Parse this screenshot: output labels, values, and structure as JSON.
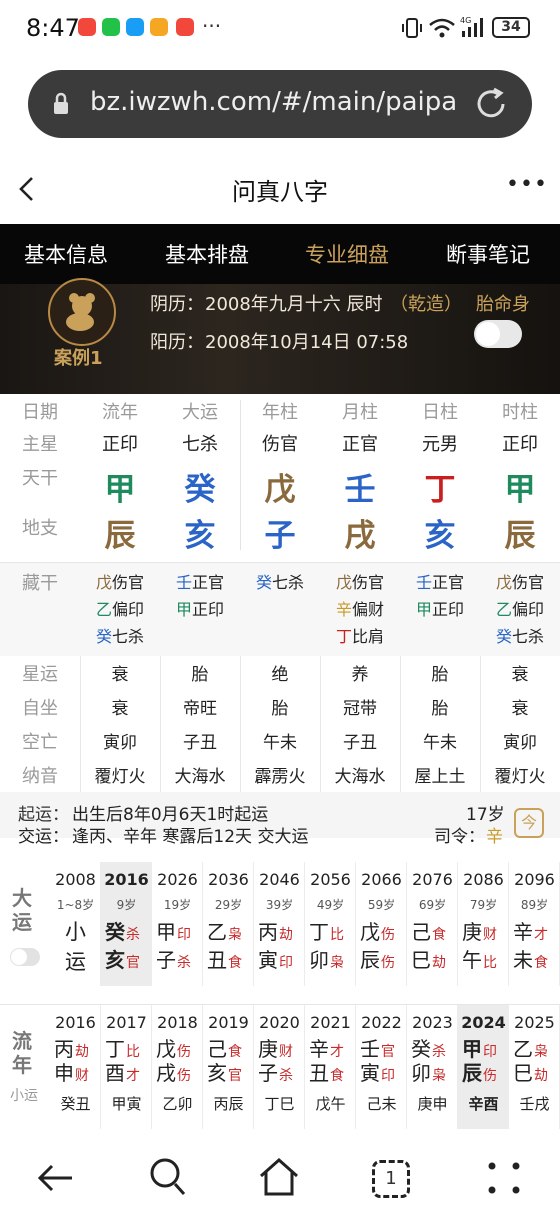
{
  "status": {
    "time": "8:47",
    "dots": "···",
    "battery": "34"
  },
  "browser": {
    "url": "bz.iwzwh.com/#/main/paipa"
  },
  "nav": {
    "title": "问真八字",
    "more": "•••"
  },
  "tabs": [
    "基本信息",
    "基本排盘",
    "专业细盘",
    "断事笔记"
  ],
  "info": {
    "case": "案例1",
    "lunar_label": "阴历：",
    "lunar": "2008年九月十六 辰时",
    "gender": "（乾造）",
    "solar_label": "阳历：",
    "solar": "2008年10月14日 07:58",
    "toggle_label": "胎命身"
  },
  "pillars": {
    "headers": [
      "日期",
      "流年",
      "大运",
      "年柱",
      "月柱",
      "日柱",
      "时柱"
    ],
    "zhuxing": {
      "label": "主星",
      "values": [
        "正印",
        "七杀",
        "伤官",
        "正官",
        "元男",
        "正印"
      ]
    },
    "tiangan": {
      "label": "天干",
      "values": [
        "甲",
        "癸",
        "戊",
        "壬",
        "丁",
        "甲"
      ],
      "colors": [
        "#1f8a5e",
        "#2a64c6",
        "#8a6a3c",
        "#2a64c6",
        "#c81f1f",
        "#1f8a5e"
      ]
    },
    "dizhi": {
      "label": "地支",
      "values": [
        "辰",
        "亥",
        "子",
        "戌",
        "亥",
        "辰"
      ],
      "colors": [
        "#8a6a3c",
        "#2a64c6",
        "#2a64c6",
        "#8a6a3c",
        "#2a64c6",
        "#8a6a3c"
      ]
    }
  },
  "canggan": {
    "label": "藏干",
    "cols": [
      [
        [
          "戊",
          "伤官",
          "#8a6a3c"
        ],
        [
          "乙",
          "偏印",
          "#1f8a5e"
        ],
        [
          "癸",
          "七杀",
          "#2a64c6"
        ]
      ],
      [
        [
          "壬",
          "正官",
          "#2a64c6"
        ],
        [
          "甲",
          "正印",
          "#1f8a5e"
        ]
      ],
      [
        [
          "癸",
          "七杀",
          "#2a64c6"
        ]
      ],
      [
        [
          "戊",
          "伤官",
          "#8a6a3c"
        ],
        [
          "辛",
          "偏财",
          "#c89a2a"
        ],
        [
          "丁",
          "比肩",
          "#c81f1f"
        ]
      ],
      [
        [
          "壬",
          "正官",
          "#2a64c6"
        ],
        [
          "甲",
          "正印",
          "#1f8a5e"
        ]
      ],
      [
        [
          "戊",
          "伤官",
          "#8a6a3c"
        ],
        [
          "乙",
          "偏印",
          "#1f8a5e"
        ],
        [
          "癸",
          "七杀",
          "#2a64c6"
        ]
      ]
    ]
  },
  "extra": [
    {
      "label": "星运",
      "values": [
        "衰",
        "胎",
        "绝",
        "养",
        "胎",
        "衰"
      ]
    },
    {
      "label": "自坐",
      "values": [
        "衰",
        "帝旺",
        "胎",
        "冠带",
        "胎",
        "衰"
      ]
    },
    {
      "label": "空亡",
      "values": [
        "寅卯",
        "子丑",
        "午未",
        "子丑",
        "午未",
        "寅卯"
      ]
    },
    {
      "label": "纳音",
      "values": [
        "覆灯火",
        "大海水",
        "霹雳火",
        "大海水",
        "屋上土",
        "覆灯火"
      ]
    }
  ],
  "qiyun": {
    "line1_label": "起运：",
    "line1": "出生后8年0月6天1时起运",
    "line2_label": "交运：",
    "line2": "逢丙、辛年 寒露后12天 交大运",
    "age": "17岁",
    "siling_label": "司令：",
    "siling": "辛",
    "calendar_icon": "今"
  },
  "dayun": {
    "label": "大运",
    "items": [
      {
        "year": "2008",
        "age": "1~8岁",
        "top": "小",
        "bot": "运"
      },
      {
        "year": "2016",
        "age": "9岁",
        "g": "癸",
        "gs": "杀",
        "z": "亥",
        "zs": "官",
        "sel": true
      },
      {
        "year": "2026",
        "age": "19岁",
        "g": "甲",
        "gs": "印",
        "z": "子",
        "zs": "杀"
      },
      {
        "year": "2036",
        "age": "29岁",
        "g": "乙",
        "gs": "枭",
        "z": "丑",
        "zs": "食"
      },
      {
        "year": "2046",
        "age": "39岁",
        "g": "丙",
        "gs": "劫",
        "z": "寅",
        "zs": "印"
      },
      {
        "year": "2056",
        "age": "49岁",
        "g": "丁",
        "gs": "比",
        "z": "卯",
        "zs": "枭"
      },
      {
        "year": "2066",
        "age": "59岁",
        "g": "戊",
        "gs": "伤",
        "z": "辰",
        "zs": "伤"
      },
      {
        "year": "2076",
        "age": "69岁",
        "g": "己",
        "gs": "食",
        "z": "巳",
        "zs": "劫"
      },
      {
        "year": "2086",
        "age": "79岁",
        "g": "庚",
        "gs": "财",
        "z": "午",
        "zs": "比"
      },
      {
        "year": "2096",
        "age": "89岁",
        "g": "辛",
        "gs": "才",
        "z": "未",
        "zs": "食"
      }
    ]
  },
  "liunian": {
    "label": "流年",
    "sub": "小运",
    "items": [
      {
        "year": "2016",
        "g": "丙",
        "gs": "劫",
        "z": "申",
        "zs": "财",
        "x": "癸丑"
      },
      {
        "year": "2017",
        "g": "丁",
        "gs": "比",
        "z": "酉",
        "zs": "才",
        "x": "甲寅"
      },
      {
        "year": "2018",
        "g": "戊",
        "gs": "伤",
        "z": "戌",
        "zs": "伤",
        "x": "乙卯"
      },
      {
        "year": "2019",
        "g": "己",
        "gs": "食",
        "z": "亥",
        "zs": "官",
        "x": "丙辰"
      },
      {
        "year": "2020",
        "g": "庚",
        "gs": "财",
        "z": "子",
        "zs": "杀",
        "x": "丁巳"
      },
      {
        "year": "2021",
        "g": "辛",
        "gs": "才",
        "z": "丑",
        "zs": "食",
        "x": "戊午"
      },
      {
        "year": "2022",
        "g": "壬",
        "gs": "官",
        "z": "寅",
        "zs": "印",
        "x": "己未"
      },
      {
        "year": "2023",
        "g": "癸",
        "gs": "杀",
        "z": "卯",
        "zs": "枭",
        "x": "庚申"
      },
      {
        "year": "2024",
        "g": "甲",
        "gs": "印",
        "z": "辰",
        "zs": "伤",
        "x": "辛酉",
        "sel": true
      },
      {
        "year": "2025",
        "g": "乙",
        "gs": "枭",
        "z": "巳",
        "zs": "劫",
        "x": "壬戌"
      }
    ]
  },
  "bottom_nav": {
    "tab_count": "1"
  }
}
